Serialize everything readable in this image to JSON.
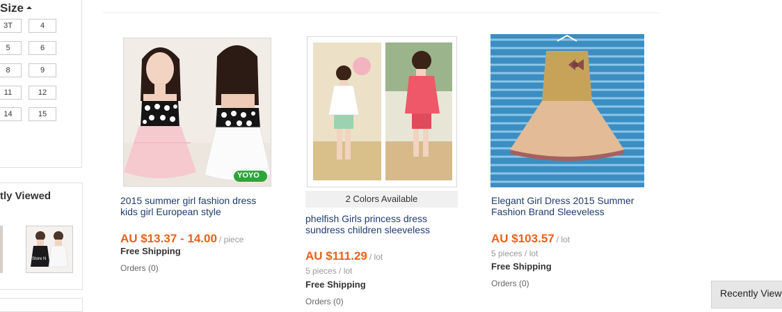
{
  "sidebar": {
    "size_filter": {
      "title": "Size",
      "options": [
        {
          "label": "3T"
        },
        {
          "label": "4"
        },
        {
          "label": "5"
        },
        {
          "label": "6"
        },
        {
          "label": "8"
        },
        {
          "label": "9"
        },
        {
          "label": "11"
        },
        {
          "label": "12"
        },
        {
          "label": "14"
        },
        {
          "label": "15"
        }
      ]
    },
    "recently_viewed": {
      "title": "tly Viewed",
      "thumb_watermark": "Store N"
    }
  },
  "products": [
    {
      "title_line1": "2015 summer girl fashion dress",
      "title_line2": "kids girl European style",
      "price": "AU $13.37 - 14.00",
      "unit": "/ piece",
      "shipping": "Free Shipping",
      "orders": "Orders (0)",
      "badge": "YOYO"
    },
    {
      "colors_available": "2 Colors Available",
      "title_line1": "phelfish Girls princess dress",
      "title_line2": "sundress children sleeveless",
      "price": "AU $111.29",
      "unit": "/ lot",
      "pieces": "5 pieces / lot",
      "shipping": "Free Shipping",
      "orders": "Orders (0)"
    },
    {
      "title_line1": "Elegant Girl Dress 2015 Summer",
      "title_line2": "Fashion Brand Sleeveless",
      "price": "AU $103.57",
      "unit": "/ lot",
      "pieces": "5 pieces / lot",
      "shipping": "Free Shipping",
      "orders": "Orders (0)"
    }
  ],
  "recently_viewed_tab": {
    "label": "Recently View"
  }
}
